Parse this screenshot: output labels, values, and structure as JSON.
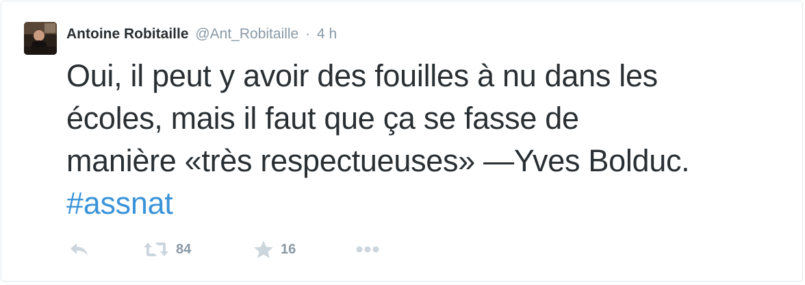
{
  "tweet": {
    "fullname": "Antoine Robitaille",
    "username": "@Ant_Robitaille",
    "separator": "·",
    "time": "4 h",
    "text_lines": [
      "Oui, il peut y avoir des fouilles à nu dans les",
      "écoles, mais il faut que ça se fasse de",
      "manière «très respectueuses» —Yves Bolduc."
    ],
    "hashtag": "#assnat",
    "retweet_count": "84",
    "favorite_count": "16"
  },
  "icons": {
    "reply": "reply-icon",
    "retweet": "retweet-icon",
    "favorite": "star-icon",
    "more": "more-dots-icon"
  },
  "colors": {
    "text": "#292f33",
    "muted": "#8899a6",
    "hashtag": "#3b94d9",
    "icon": "#ccd6dd",
    "border": "#e1e8ed"
  }
}
